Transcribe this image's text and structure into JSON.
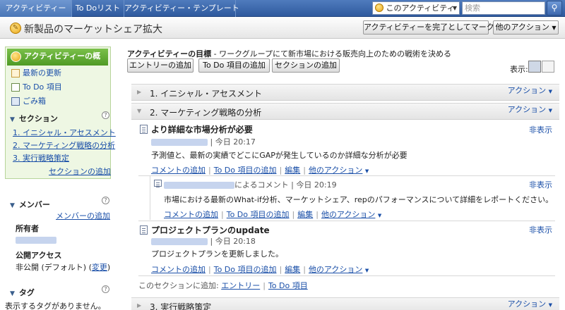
{
  "nav": {
    "tabs": [
      "アクティビティー",
      "To Doリスト",
      "アクティビティー・テンプレート"
    ],
    "context_select": "このアクティビティー",
    "search_placeholder": "検索"
  },
  "header": {
    "title": "新製品のマーケットシェア拡大",
    "complete_button": "アクティビティーを完了としてマーク",
    "other_actions_button": "他のアクション"
  },
  "sidebar": {
    "active_item": "アクティビティーの概略",
    "items": [
      "最新の更新",
      "To Do 項目",
      "ごみ箱"
    ],
    "sections_heading": "セクション",
    "sections": [
      "1. イニシャル・アセスメント",
      "2. マーケティング戦略の分析",
      "3. 実行戦略策定"
    ],
    "add_section": "セクションの追加",
    "members_heading": "メンバー",
    "add_member": "メンバーの追加",
    "owner_label": "所有者",
    "public_access_label": "公開アクセス",
    "public_access_value": "非公開 (デフォルト)",
    "change_link": "変更",
    "tags_heading": "タグ",
    "no_tags": "表示するタグがありません。"
  },
  "main": {
    "goal_label": "アクティビティーの目標",
    "goal_text": " - ワークグループにて新市場における販売向上のための戦術を決める",
    "add_entry": "エントリーの追加",
    "add_todo": "To Do 項目の追加",
    "add_section": "セクションの追加",
    "display_label": "表示:",
    "action_label": "アクション",
    "hide_label": "非表示",
    "sections": [
      {
        "label": "1. イニシャル・アセスメント"
      },
      {
        "label": "2. マーケティング戦略の分析"
      },
      {
        "label": "3. 実行戦略策定"
      }
    ],
    "entries": [
      {
        "title": "より詳細な市場分析が必要",
        "time": "| 今日  20:17",
        "body": "予測値と、最新の実績でどこにGAPが発生しているのか詳細な分析が必要"
      },
      {
        "title": "プロジェクトプランのupdate",
        "time": "| 今日  20:18",
        "body": "プロジェクトプランを更新しました。"
      }
    ],
    "comment": {
      "by": "によるコメント",
      "time": "| 今日  20:19",
      "body": "市場における最新のWhat-if分析、マーケットシェア、repのパフォーマンスについて詳細をレポートください。"
    },
    "entry_actions": {
      "add_comment": "コメントの追加",
      "add_todo": "To Do 項目の追加",
      "edit": "編集",
      "other": "他のアクション"
    },
    "add_to_section_label": "このセクションに追加:",
    "add_to_section_entry": "エントリー",
    "add_to_section_todo": "To Do 項目"
  }
}
